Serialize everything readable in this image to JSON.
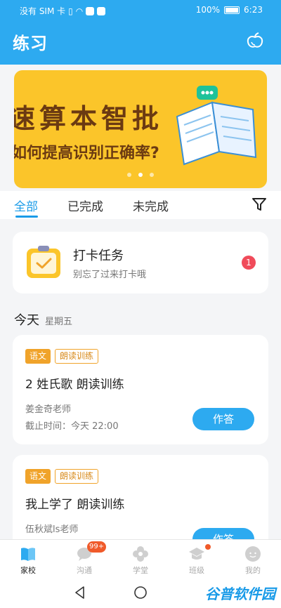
{
  "status_bar": {
    "carrier": "没有 SIM 卡",
    "battery": "100%",
    "time": "6:23"
  },
  "header": {
    "title": "练习",
    "right_icon": "apple-icon"
  },
  "banner": {
    "title": "速算本智批",
    "subtitle": "如何提高识别正确率?",
    "active_dot": 2,
    "dots": 3
  },
  "tabs": [
    {
      "label": "全部",
      "active": true
    },
    {
      "label": "已完成",
      "active": false
    },
    {
      "label": "未完成",
      "active": false
    }
  ],
  "checkin": {
    "title": "打卡任务",
    "subtitle": "别忘了过来打卡哦",
    "count": "1"
  },
  "day": {
    "label": "今天",
    "weekday": "星期五"
  },
  "tasks": [
    {
      "subject": "语文",
      "type": "朗读训练",
      "title": "2 姓氏歌 朗读训练",
      "teacher": "姜金奇老师",
      "deadline": "截止时间：今天 22:00",
      "button": "作答"
    },
    {
      "subject": "语文",
      "type": "朗读训练",
      "title": "我上学了 朗读训练",
      "teacher": "伍秋斌ls老师",
      "button": "作答"
    }
  ],
  "bottom_nav": [
    {
      "label": "家校",
      "icon": "book-icon",
      "active": true
    },
    {
      "label": "沟通",
      "icon": "chat-icon",
      "badge": "99+"
    },
    {
      "label": "学堂",
      "icon": "flower-icon"
    },
    {
      "label": "班级",
      "icon": "cap-icon",
      "dot": true
    },
    {
      "label": "我的",
      "icon": "avatar-icon"
    }
  ],
  "watermark": "谷普软件园",
  "colors": {
    "primary": "#2daaf0",
    "tag": "#f0a32a",
    "badge": "#f04b5a",
    "banner": "#fbc52a"
  }
}
